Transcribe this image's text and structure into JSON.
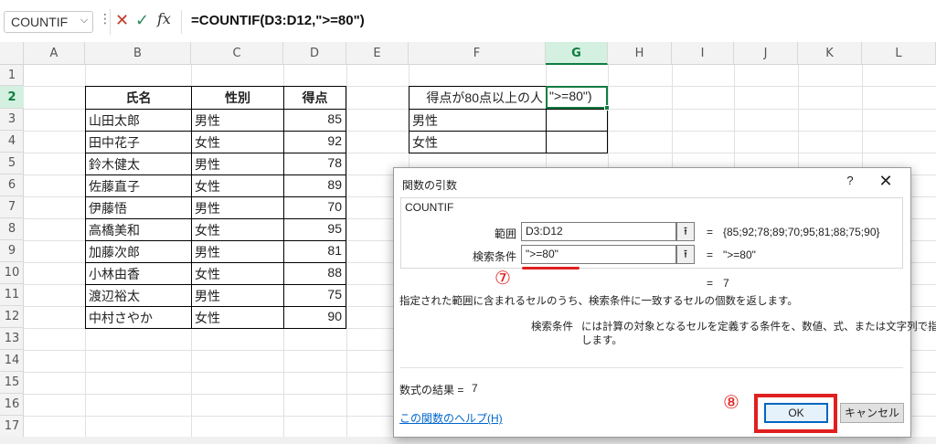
{
  "formula_bar": {
    "name_box": "COUNTIF",
    "formula": "=COUNTIF(D3:D12,\">=80\")"
  },
  "grid": {
    "columns": [
      "A",
      "B",
      "C",
      "D",
      "E",
      "F",
      "G",
      "H",
      "I",
      "J",
      "K",
      "L"
    ],
    "rows": [
      "1",
      "2",
      "3",
      "4",
      "5",
      "6",
      "7",
      "8",
      "9",
      "10",
      "11",
      "12",
      "13",
      "14",
      "15",
      "16",
      "17"
    ],
    "selected_column": "G",
    "selected_row": "2"
  },
  "table": {
    "headers": [
      "氏名",
      "性別",
      "得点"
    ],
    "rows": [
      [
        "山田太郎",
        "男性",
        "85"
      ],
      [
        "田中花子",
        "女性",
        "92"
      ],
      [
        "鈴木健太",
        "男性",
        "78"
      ],
      [
        "佐藤直子",
        "女性",
        "89"
      ],
      [
        "伊藤悟",
        "男性",
        "70"
      ],
      [
        "高橋美和",
        "女性",
        "95"
      ],
      [
        "加藤次郎",
        "男性",
        "81"
      ],
      [
        "小林由香",
        "女性",
        "88"
      ],
      [
        "渡辺裕太",
        "男性",
        "75"
      ],
      [
        "中村さやか",
        "女性",
        "90"
      ]
    ]
  },
  "summary": {
    "header": "得点が80点以上の人",
    "active_value": "\">=80\")",
    "row_labels": [
      "男性",
      "女性"
    ]
  },
  "dialog": {
    "title": "関数の引数",
    "help_symbol": "?",
    "close_symbol": "✕",
    "function_name": "COUNTIF",
    "range_label": "範囲",
    "range_value": "D3:D12",
    "range_result": "{85;92;78;89;70;95;81;88;75;90}",
    "criteria_label": "検索条件",
    "criteria_value": "\">=80\"",
    "criteria_result": "\">=80\"",
    "eq_sign": "=",
    "function_result": "7",
    "description": "指定された範囲に含まれるセルのうち、検索条件に一致するセルの個数を返します。",
    "arg_desc_label": "検索条件",
    "arg_desc_line1": "には計算の対象となるセルを定義する条件を、数値、式、または文字列で指定",
    "arg_desc_line2": "します。",
    "formula_result_label": "数式の結果 =",
    "formula_result_value": "7",
    "help_link": "この関数のヘルプ(H)",
    "ok_label": "OK",
    "cancel_label": "キャンセル"
  },
  "annotations": {
    "step7": "⑦",
    "step8": "⑧"
  },
  "colors": {
    "accent": "#107c41",
    "annotation": "#e02020",
    "link": "#0066cc"
  }
}
